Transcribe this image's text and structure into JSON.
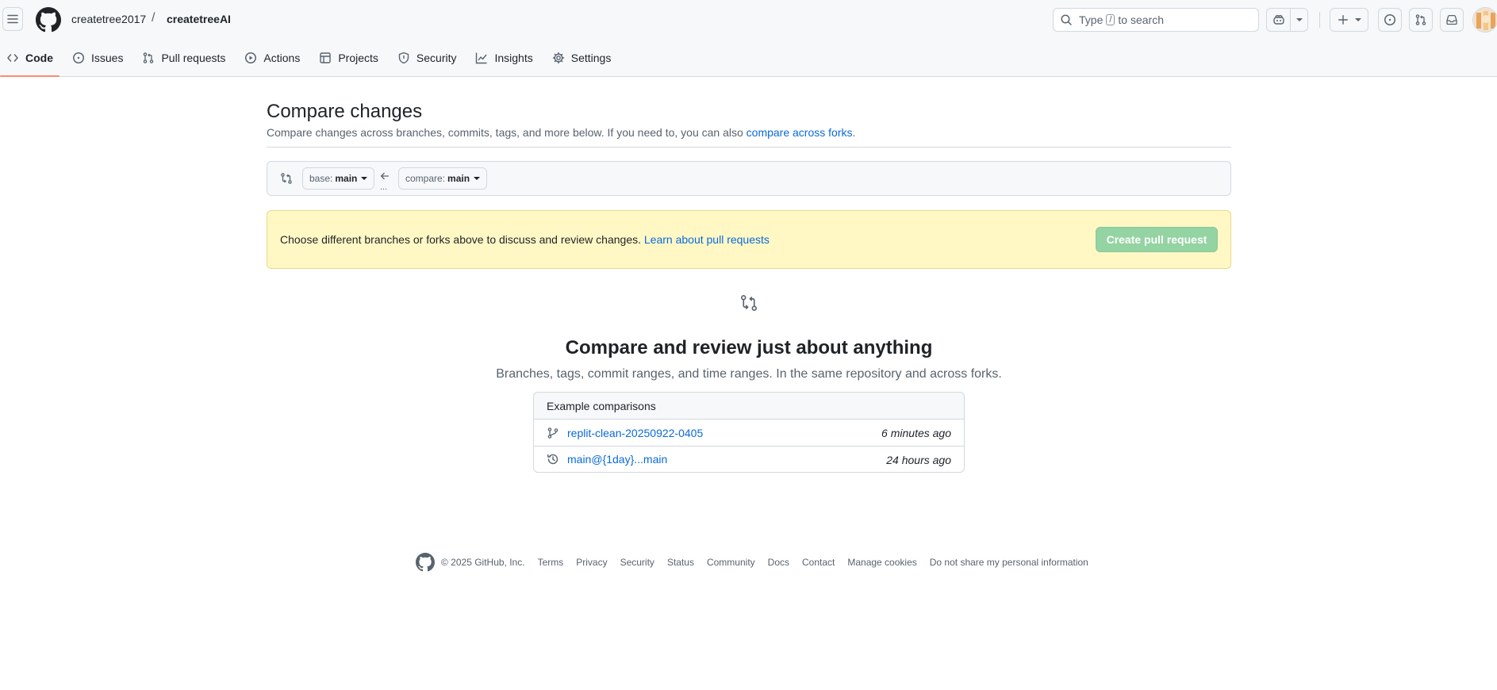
{
  "header": {
    "owner": "createtree2017",
    "separator": "/",
    "repo": "createtreeAI",
    "search": {
      "prefix": "Type",
      "key": "/",
      "suffix": "to search"
    }
  },
  "tabs": [
    {
      "label": "Code",
      "icon": "code-icon",
      "active": true
    },
    {
      "label": "Issues",
      "icon": "issue-opened-icon"
    },
    {
      "label": "Pull requests",
      "icon": "git-pull-request-icon"
    },
    {
      "label": "Actions",
      "icon": "play-icon"
    },
    {
      "label": "Projects",
      "icon": "table-icon"
    },
    {
      "label": "Security",
      "icon": "shield-icon"
    },
    {
      "label": "Insights",
      "icon": "graph-icon"
    },
    {
      "label": "Settings",
      "icon": "gear-icon"
    }
  ],
  "main": {
    "title": "Compare changes",
    "subtitle": "Compare changes across branches, commits, tags, and more below. If you need to, you can also",
    "subtitle_link": "compare across forks",
    "subtitle_end": ".",
    "base": {
      "prefix": "base:",
      "value": "main"
    },
    "compare": {
      "prefix": "compare:",
      "value": "main"
    },
    "dots": "...",
    "flash": {
      "text": "Choose different branches or forks above to discuss and review changes.",
      "link": "Learn about pull requests",
      "button": "Create pull request"
    },
    "blank": {
      "title": "Compare and review just about anything",
      "subtitle": "Branches, tags, commit ranges, and time ranges. In the same repository and across forks."
    },
    "examples": {
      "header": "Example comparisons",
      "rows": [
        {
          "label": "replit-clean-20250922-0405",
          "time": "6 minutes ago",
          "icon": "git-branch-icon"
        },
        {
          "label": "main@{1day}...main",
          "time": "24 hours ago",
          "icon": "history-icon"
        }
      ]
    }
  },
  "footer": {
    "copyright": "© 2025 GitHub, Inc.",
    "links": [
      "Terms",
      "Privacy",
      "Security",
      "Status",
      "Community",
      "Docs",
      "Contact",
      "Manage cookies",
      "Do not share my personal information"
    ]
  },
  "colors": {
    "accent": "#0969da",
    "tab_underline": "#fd8c73",
    "flash_bg": "#fff8c5",
    "button_disabled": "#94d3a2"
  }
}
